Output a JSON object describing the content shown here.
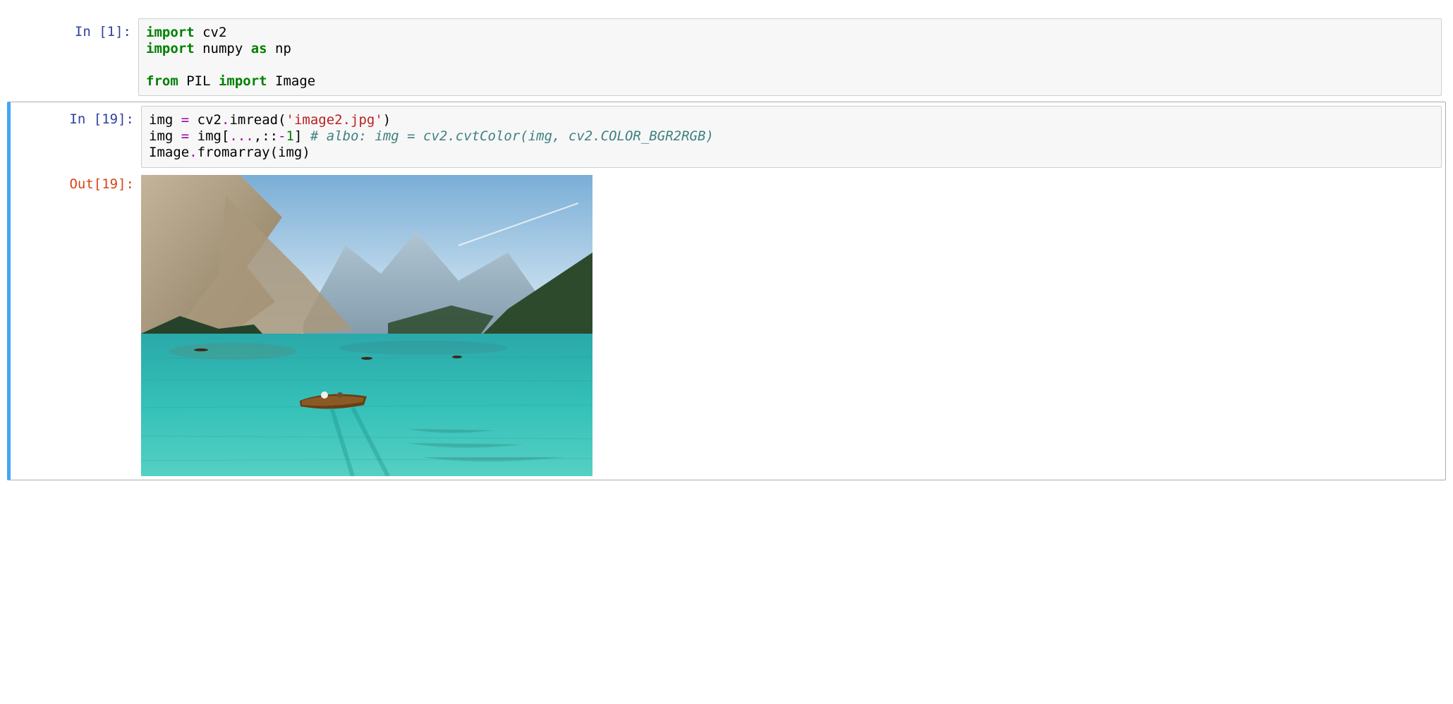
{
  "cells": [
    {
      "prompt_in": "In [1]:",
      "code": {
        "line1_kw1": "import",
        "line1_rest": " cv2",
        "line2_kw1": "import",
        "line2_mid": " numpy ",
        "line2_kw2": "as",
        "line2_rest": " np",
        "line4_kw1": "from",
        "line4_mid": " PIL ",
        "line4_kw2": "import",
        "line4_rest": " Image"
      }
    },
    {
      "prompt_in": "In [19]:",
      "prompt_out": "Out[19]:",
      "code": {
        "l1_a": "img ",
        "l1_op": "=",
        "l1_b": " cv2",
        "l1_op2": ".",
        "l1_c": "imread(",
        "l1_str": "'image2.jpg'",
        "l1_d": ")",
        "l2_a": "img ",
        "l2_op": "=",
        "l2_b": " img[",
        "l2_op2": "...",
        "l2_c": ",::",
        "l2_op3": "-",
        "l2_num": "1",
        "l2_d": "] ",
        "l2_comment": "# albo: img = cv2.cvtColor(img, cv2.COLOR_BGR2RGB)",
        "l3_a": "Image",
        "l3_op": ".",
        "l3_b": "fromarray(img)"
      }
    }
  ]
}
